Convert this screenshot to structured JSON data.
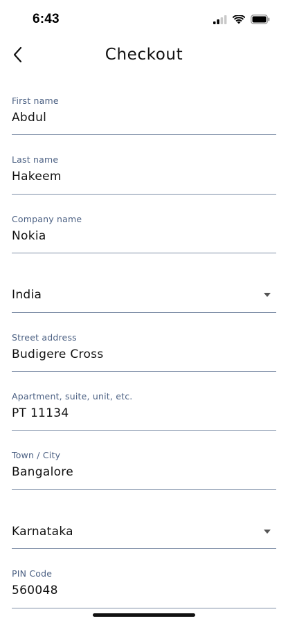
{
  "status_bar": {
    "time": "6:43"
  },
  "header": {
    "title": "Checkout",
    "back_icon": "chevron-left-icon"
  },
  "form": {
    "first_name": {
      "label": "First name",
      "value": "Abdul"
    },
    "last_name": {
      "label": "Last name",
      "value": "Hakeem"
    },
    "company_name": {
      "label": "Company name",
      "value": "Nokia"
    },
    "country": {
      "value": "India"
    },
    "street_address": {
      "label": "Street address",
      "value": "Budigere Cross"
    },
    "apartment": {
      "label": "Apartment, suite, unit, etc.",
      "value": "PT 11134"
    },
    "town_city": {
      "label": "Town / City",
      "value": "Bangalore"
    },
    "state": {
      "value": "Karnataka"
    },
    "pin_code": {
      "label": "PIN Code",
      "value": "560048"
    }
  },
  "colors": {
    "label": "#4a5f82",
    "underline": "#7d8da6",
    "text": "#111111"
  }
}
